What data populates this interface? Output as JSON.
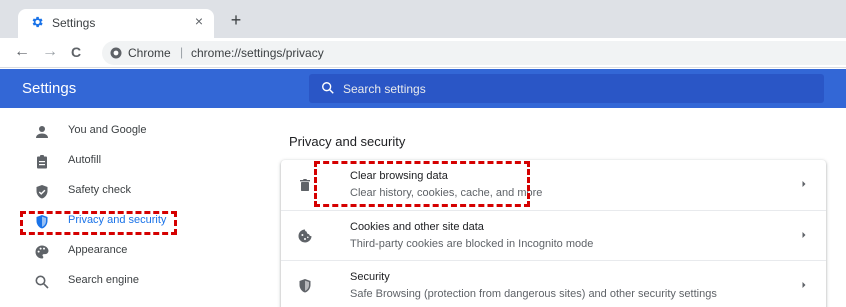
{
  "tab": {
    "title": "Settings",
    "close_glyph": "×",
    "new_tab_glyph": "+"
  },
  "toolbar": {
    "back_glyph": "←",
    "forward_glyph": "→",
    "reload_glyph": "C",
    "omnibox_label": "Chrome",
    "omnibox_separator": "|",
    "url": "chrome://settings/privacy"
  },
  "header": {
    "title": "Settings",
    "search_placeholder": "Search settings"
  },
  "sidebar": {
    "items": [
      {
        "label": "You and Google",
        "icon": "person-icon"
      },
      {
        "label": "Autofill",
        "icon": "clipboard-icon"
      },
      {
        "label": "Safety check",
        "icon": "shield-check-icon"
      },
      {
        "label": "Privacy and security",
        "icon": "shield-icon",
        "active": true
      },
      {
        "label": "Appearance",
        "icon": "palette-icon"
      },
      {
        "label": "Search engine",
        "icon": "search-icon"
      }
    ]
  },
  "main": {
    "section_title": "Privacy and security",
    "rows": [
      {
        "title": "Clear browsing data",
        "subtitle": "Clear history, cookies, cache, and more",
        "icon": "trash-icon"
      },
      {
        "title": "Cookies and other site data",
        "subtitle": "Third-party cookies are blocked in Incognito mode",
        "icon": "cookie-icon"
      },
      {
        "title": "Security",
        "subtitle": "Safe Browsing (protection from dangerous sites) and other security settings",
        "icon": "shield-icon"
      }
    ]
  },
  "colors": {
    "header_bg": "#3367d6",
    "search_bg": "#2a56c6",
    "active_blue": "#1a73e8",
    "icon_gray": "#5f6368",
    "highlight_red": "#d50000"
  }
}
